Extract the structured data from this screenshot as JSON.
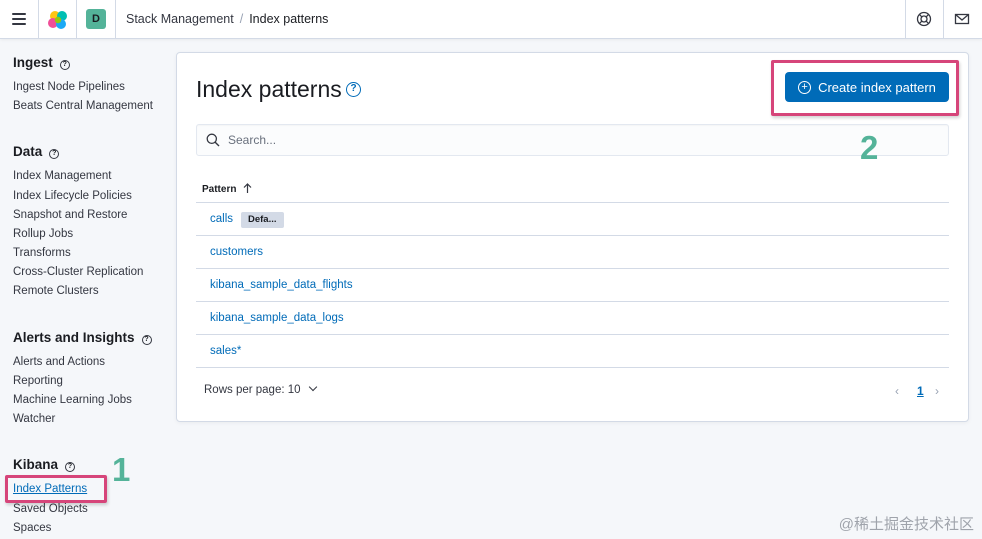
{
  "header": {
    "space_initial": "D",
    "breadcrumbs": [
      "Stack Management",
      "Index patterns"
    ]
  },
  "sidebar": {
    "sections": [
      {
        "title": "Ingest",
        "items": [
          "Ingest Node Pipelines",
          "Beats Central Management"
        ]
      },
      {
        "title": "Data",
        "items": [
          "Index Management",
          "Index Lifecycle Policies",
          "Snapshot and Restore",
          "Rollup Jobs",
          "Transforms",
          "Cross-Cluster Replication",
          "Remote Clusters"
        ]
      },
      {
        "title": "Alerts and Insights",
        "items": [
          "Alerts and Actions",
          "Reporting",
          "Machine Learning Jobs",
          "Watcher"
        ]
      },
      {
        "title": "Kibana",
        "items": [
          "Index Patterns",
          "Saved Objects",
          "Spaces"
        ]
      }
    ],
    "active_item": "Index Patterns"
  },
  "main": {
    "title": "Index patterns",
    "create_button": "Create index pattern",
    "search_placeholder": "Search...",
    "column_header": "Pattern",
    "rows": [
      {
        "name": "calls",
        "badge": "Defa..."
      },
      {
        "name": "customers"
      },
      {
        "name": "kibana_sample_data_flights"
      },
      {
        "name": "kibana_sample_data_logs"
      },
      {
        "name": "sales*"
      }
    ],
    "rows_per_page": "Rows per page: 10",
    "current_page": "1"
  },
  "annotations": {
    "step1": "1",
    "step2": "2",
    "highlight_color": "#d6457a",
    "number_color": "#54b399"
  },
  "watermark": "@稀土掘金技术社区",
  "colors": {
    "link": "#006bb8",
    "primary_button": "#006bb8",
    "avatar": "#54b399"
  }
}
